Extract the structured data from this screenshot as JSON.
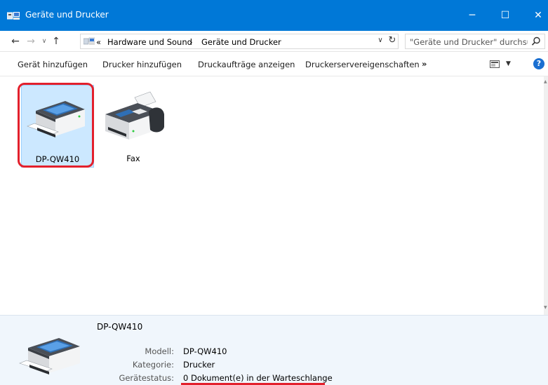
{
  "window": {
    "title": "Geräte und Drucker",
    "controls": {
      "minimize": "─",
      "maximize": "☐",
      "close": "✕"
    }
  },
  "navigation": {
    "back": "←",
    "forward": "→",
    "recent": "∨",
    "up": "↑"
  },
  "address": {
    "overflow": "«",
    "crumbs": [
      "Hardware und Sound",
      "Geräte und Drucker"
    ],
    "separator": "›",
    "dropdown": "∨",
    "refresh": "↻"
  },
  "search": {
    "placeholder": "\"Geräte und Drucker\" durchsu..."
  },
  "commandbar": {
    "items": [
      "Gerät hinzufügen",
      "Drucker hinzufügen",
      "Druckaufträge anzeigen",
      "Druckerservereigenschaften"
    ],
    "more": "»",
    "view_dropdown": "▼",
    "help": "?"
  },
  "devices": [
    {
      "label": "DP-QW410",
      "icon": "printer-icon",
      "selected": true
    },
    {
      "label": "Fax",
      "icon": "fax-icon",
      "selected": false
    }
  ],
  "details": {
    "title": "DP-QW410",
    "properties": [
      {
        "label": "Modell:",
        "value": "DP-QW410"
      },
      {
        "label": "Kategorie:",
        "value": "Drucker"
      },
      {
        "label": "Gerätestatus:",
        "value": "0 Dokument(e) in der Warteschlange"
      }
    ]
  },
  "colors": {
    "titlebar": "#0078d7",
    "selection": "#cce8ff",
    "highlight": "#e3202c",
    "details_background": "#f0f6fc"
  }
}
